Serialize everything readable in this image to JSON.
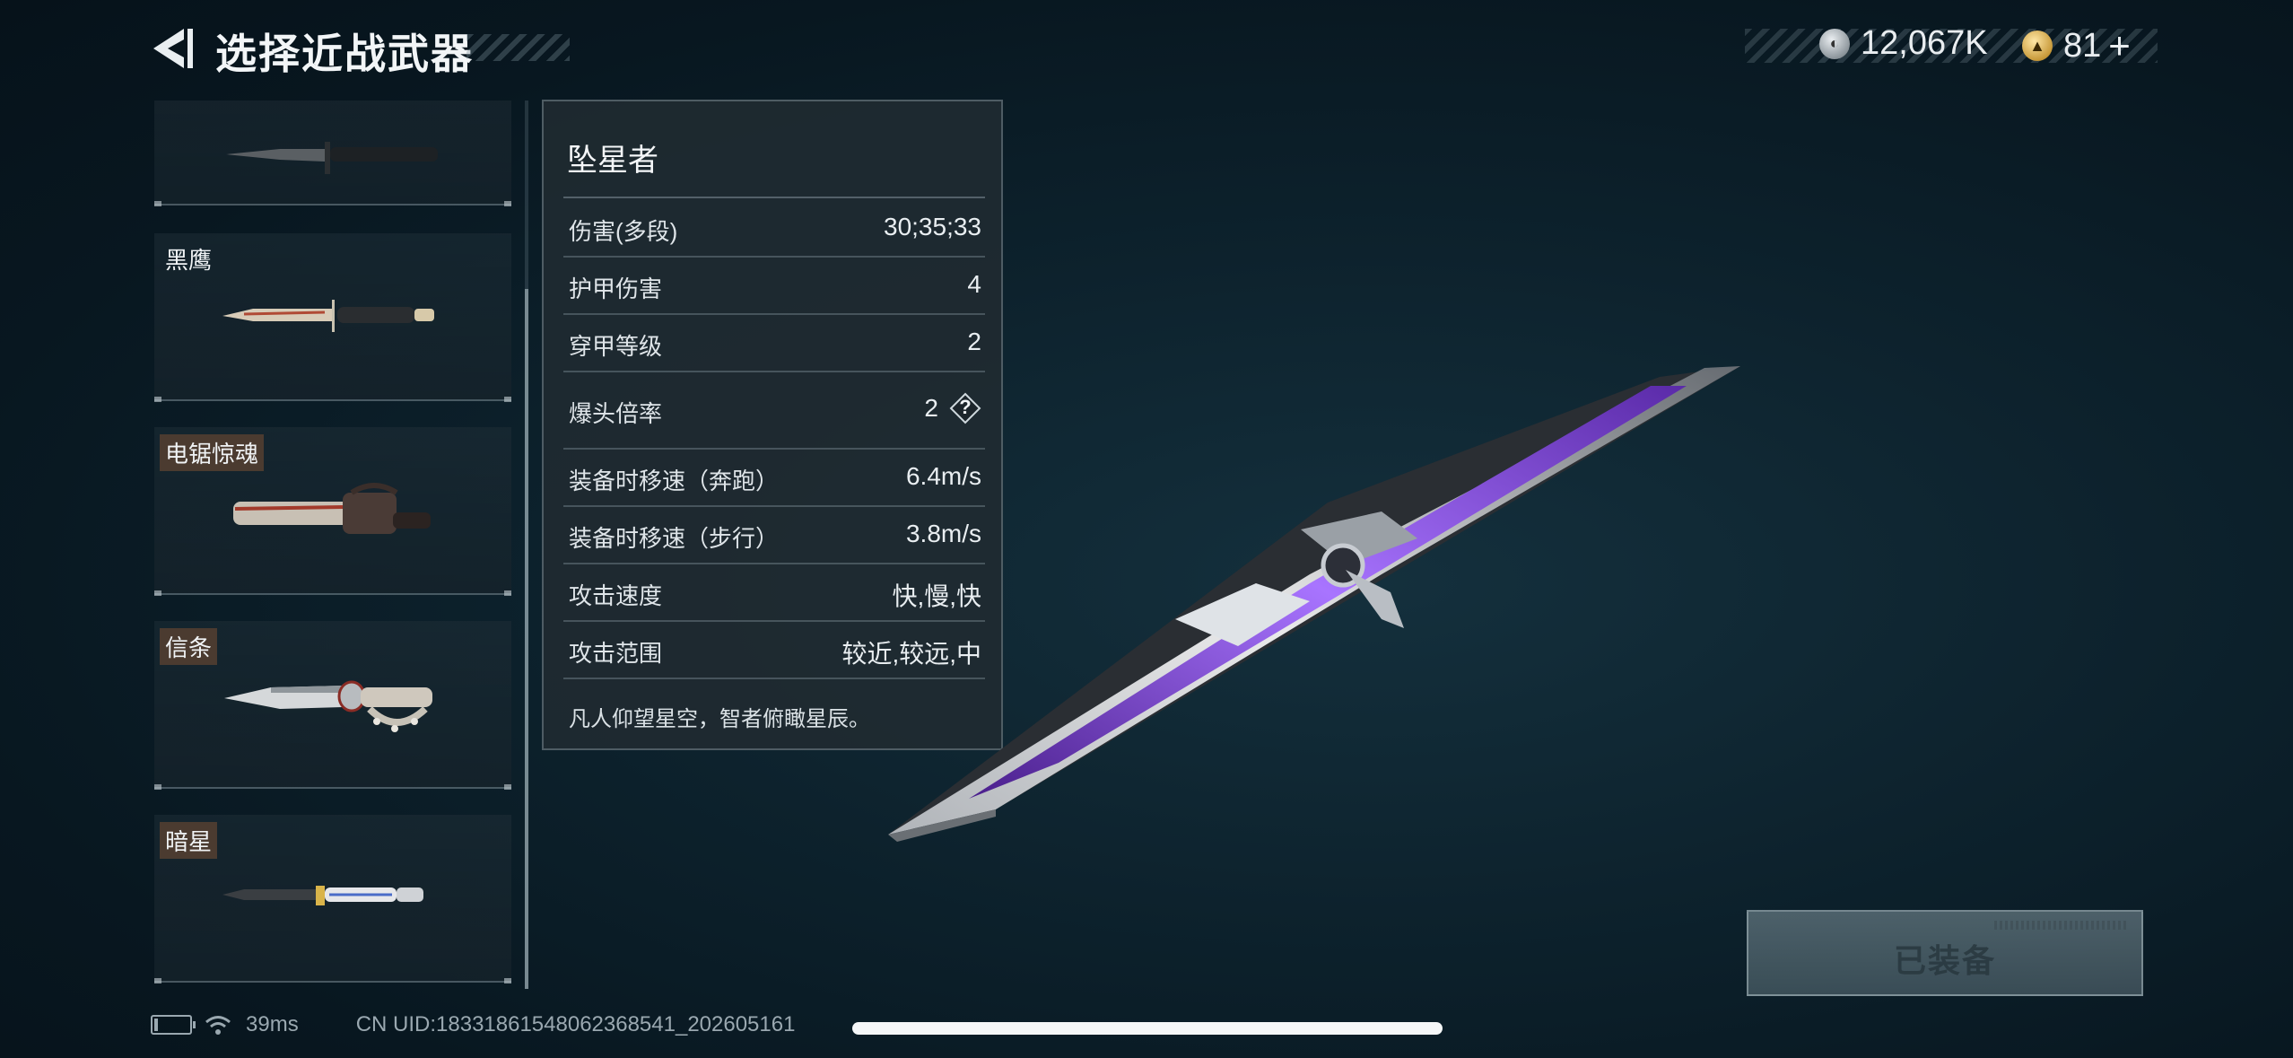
{
  "header": {
    "title": "选择近战武器",
    "currency": [
      {
        "icon": "silver-coin-icon",
        "value": "12,067K"
      },
      {
        "icon": "gold-coin-icon",
        "value": "81"
      }
    ],
    "plus_label": "+"
  },
  "weapon_list": {
    "items": [
      {
        "label": ""
      },
      {
        "label": "黑鹰"
      },
      {
        "label": "电锯惊魂"
      },
      {
        "label": "信条"
      },
      {
        "label": "暗星"
      }
    ]
  },
  "stats": {
    "title": "坠星者",
    "rows": [
      {
        "label": "伤害(多段)",
        "value": "30;35;33"
      },
      {
        "label": "护甲伤害",
        "value": "4"
      },
      {
        "label": "穿甲等级",
        "value": "2"
      },
      {
        "label": "爆头倍率",
        "value": "2",
        "help": "?"
      },
      {
        "label": "装备时移速（奔跑）",
        "value": "6.4m/s"
      },
      {
        "label": "装备时移速（步行）",
        "value": "3.8m/s"
      },
      {
        "label": "攻击速度",
        "value": "快,慢,快"
      },
      {
        "label": "攻击范围",
        "value": "较近,较远,中"
      }
    ],
    "description": "凡人仰望星空，智者俯瞰星辰。"
  },
  "equip_button": {
    "label": "已装备"
  },
  "status_bar": {
    "ping": "39ms",
    "uid": "CN UID:18331861548062368541_202605161"
  },
  "colors": {
    "background": "#0d222d",
    "panel": "#202a31",
    "accent_purple": "#8a4dff",
    "tag_brown": "#4b3b30"
  }
}
